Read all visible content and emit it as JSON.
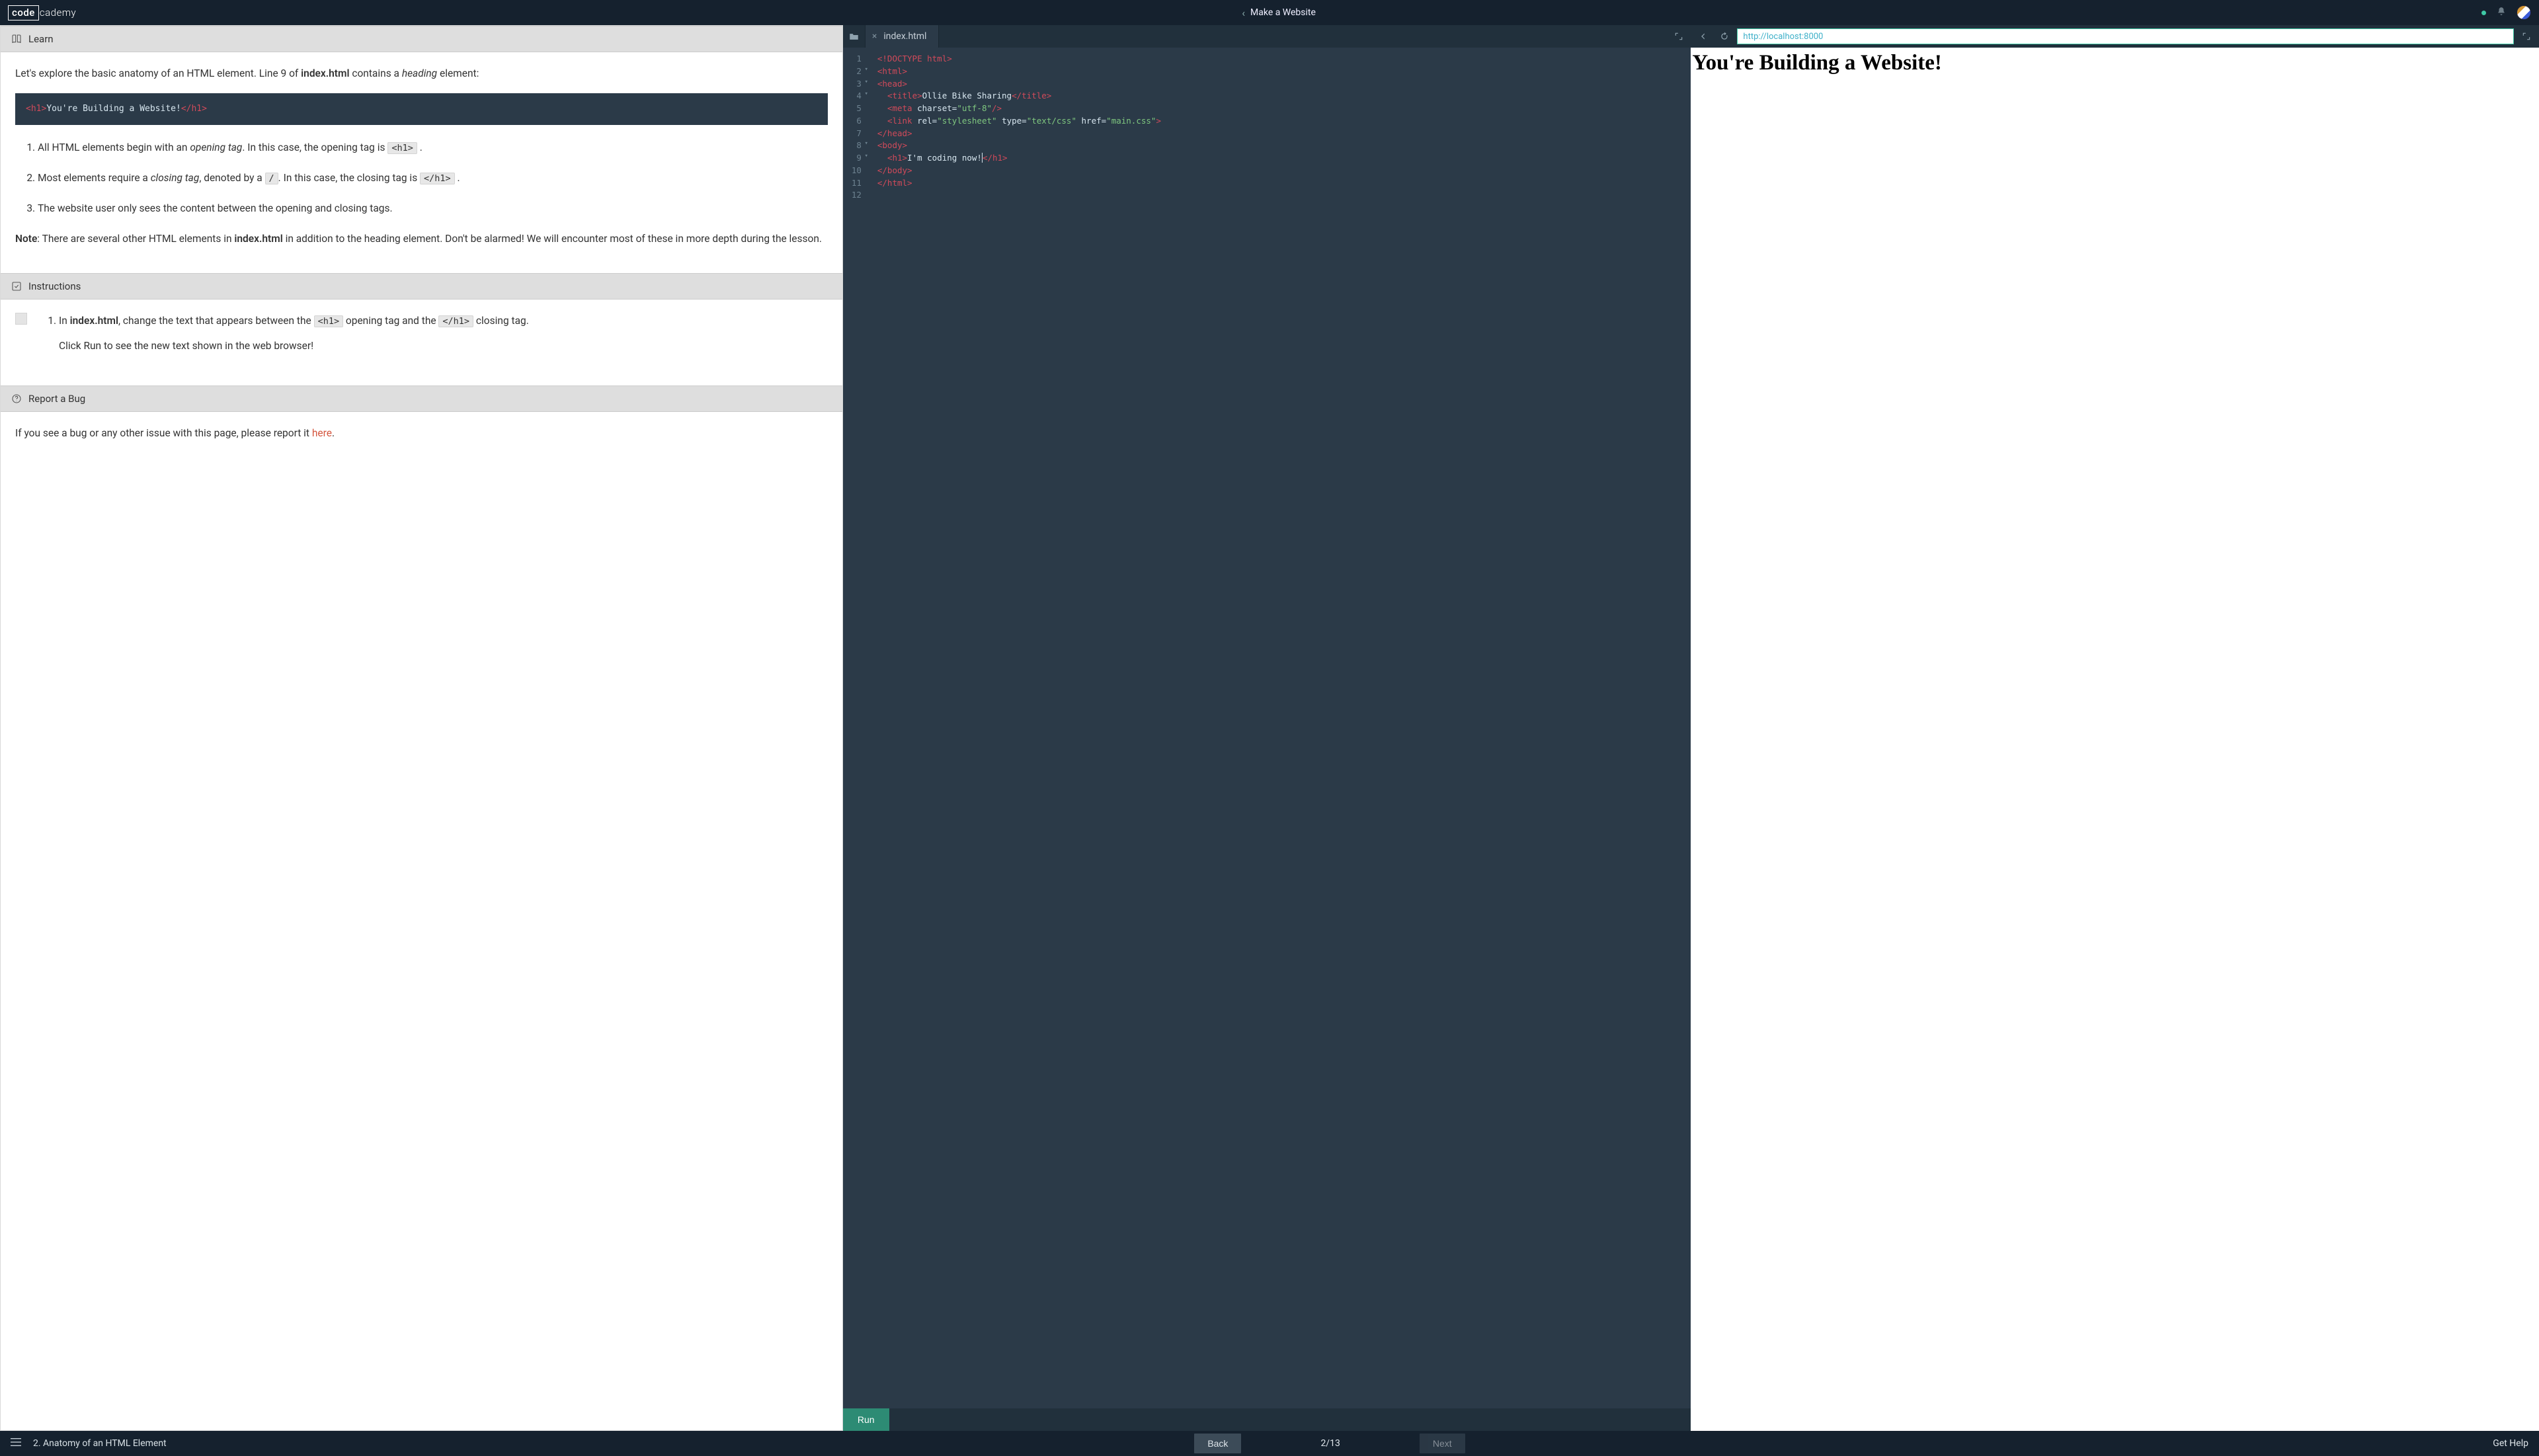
{
  "header": {
    "logo_box": "code",
    "logo_rest": "cademy",
    "course_title": "Make a Website"
  },
  "learn": {
    "heading": "Learn",
    "intro_pre": "Let's explore the basic anatomy of an HTML element. Line 9 of ",
    "intro_file": "index.html",
    "intro_mid": " contains a ",
    "intro_em": "heading",
    "intro_post": " element:",
    "code_sample_text": "You're Building a Website!",
    "li1_a": "All HTML elements begin with an ",
    "li1_em": "opening tag",
    "li1_b": ". In this case, the opening tag is ",
    "li1_code": "<h1>",
    "li2_a": "Most elements require a ",
    "li2_em": "closing tag",
    "li2_b": ", denoted by a ",
    "li2_code1": "/",
    "li2_c": ". In this case, the closing tag is ",
    "li2_code2": "</h1>",
    "li3": "The website user only sees the content between the opening and closing tags.",
    "note_label": "Note",
    "note_a": ": There are several other HTML elements in ",
    "note_file": "index.html",
    "note_b": " in addition to the heading element. Don't be alarmed! We will encounter most of these in more depth during the lesson."
  },
  "instructions": {
    "heading": "Instructions",
    "step1_a": "In ",
    "step1_file": "index.html",
    "step1_b": ", change the text that appears between the ",
    "step1_code1": "<h1>",
    "step1_c": " opening tag and the ",
    "step1_code2": "</h1>",
    "step1_d": " closing tag.",
    "step1_e": "Click Run to see the new text shown in the web browser!"
  },
  "bug": {
    "heading": "Report a Bug",
    "text": "If you see a bug or any other issue with this page, please report it ",
    "link": "here"
  },
  "editor": {
    "filename": "index.html",
    "lines": {
      "l1": "<!DOCTYPE html>",
      "l2": "<html>",
      "l3": "<head>",
      "l4_title_text": "Ollie Bike Sharing",
      "l5_charset": "utf-8",
      "l6_rel": "stylesheet",
      "l6_type": "text/css",
      "l6_href": "main.css",
      "l7": "</head>",
      "l8": "<body>",
      "l9_text": "I'm coding now!",
      "l10": "</body>",
      "l11": "</html>"
    },
    "run_label": "Run"
  },
  "browser": {
    "url": "http://localhost:8000",
    "rendered_h1": "You're Building a Website!"
  },
  "footer": {
    "lesson_title": "2. Anatomy of an HTML Element",
    "back": "Back",
    "progress": "2/13",
    "next": "Next",
    "help": "Get Help"
  }
}
